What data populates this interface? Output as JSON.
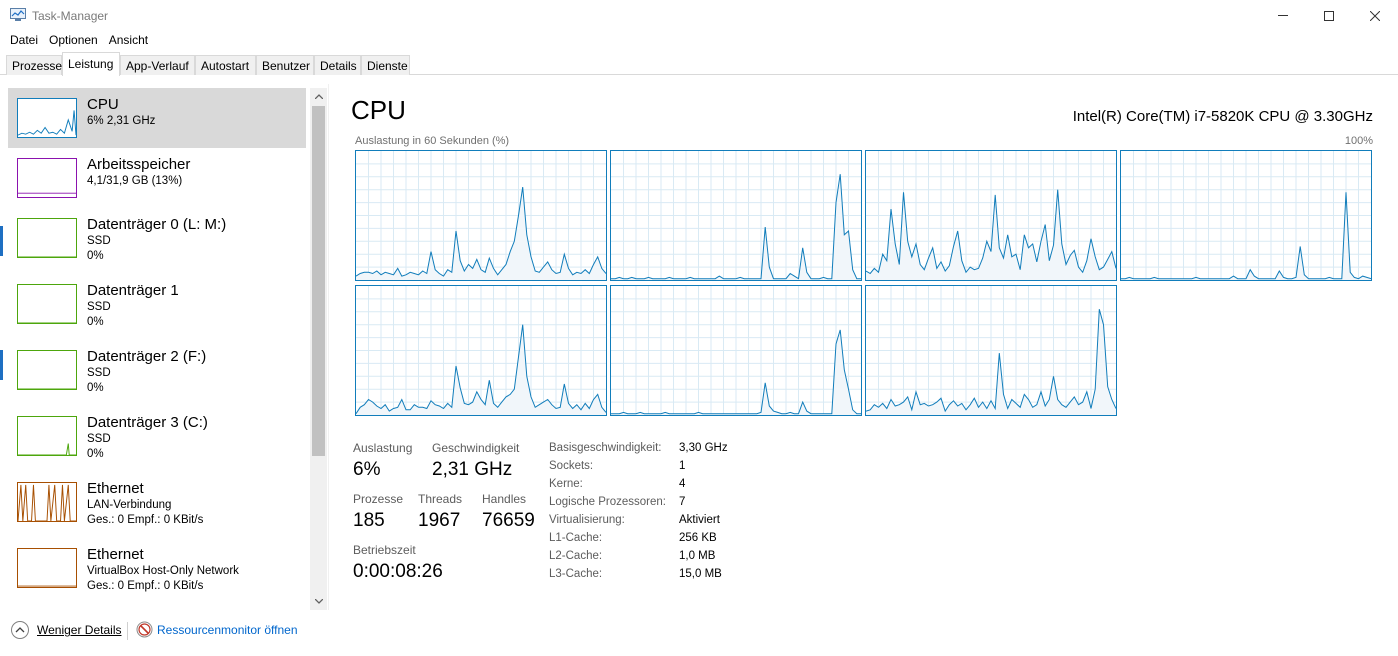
{
  "window": {
    "title": "Task-Manager"
  },
  "menu": [
    "Datei",
    "Optionen",
    "Ansicht"
  ],
  "tabs": [
    "Prozesse",
    "Leistung",
    "App-Verlauf",
    "Autostart",
    "Benutzer",
    "Details",
    "Dienste"
  ],
  "active_tab": "Leistung",
  "sidebar": {
    "items": [
      {
        "name": "CPU",
        "lines": [
          "6% 2,31 GHz"
        ],
        "color": "#117dbb",
        "selected": true
      },
      {
        "name": "Arbeitsspeicher",
        "lines": [
          "4,1/31,9 GB (13%)"
        ],
        "color": "#8b12ae"
      },
      {
        "name": "Datenträger 0 (L: M:)",
        "lines": [
          "SSD",
          "0%"
        ],
        "color": "#4da60c"
      },
      {
        "name": "Datenträger 1",
        "lines": [
          "SSD",
          "0%"
        ],
        "color": "#4da60c"
      },
      {
        "name": "Datenträger 2 (F:)",
        "lines": [
          "SSD",
          "0%"
        ],
        "color": "#4da60c"
      },
      {
        "name": "Datenträger 3 (C:)",
        "lines": [
          "SSD",
          "0%"
        ],
        "color": "#4da60c"
      },
      {
        "name": "Ethernet",
        "lines": [
          "LAN-Verbindung",
          "Ges.: 0 Empf.: 0 KBit/s"
        ],
        "color": "#a74f01"
      },
      {
        "name": "Ethernet",
        "lines": [
          "VirtualBox Host-Only Network",
          "Ges.: 0 Empf.: 0 KBit/s"
        ],
        "color": "#a74f01"
      }
    ]
  },
  "main": {
    "title": "CPU",
    "model": "Intel(R) Core(TM) i7-5820K CPU @ 3.30GHz",
    "graph_label": "Auslastung in 60 Sekunden (%)",
    "graph_max": "100%",
    "graph_color": "#117dbb",
    "stats": {
      "auslastung_label": "Auslastung",
      "auslastung": "6%",
      "geschw_label": "Geschwindigkeit",
      "geschw": "2,31 GHz",
      "prozesse_label": "Prozesse",
      "prozesse": "185",
      "threads_label": "Threads",
      "threads": "1967",
      "handles_label": "Handles",
      "handles": "76659",
      "betrieb_label": "Betriebszeit",
      "betrieb": "0:00:08:26"
    },
    "details": [
      {
        "label": "Basisgeschwindigkeit:",
        "value": "3,30 GHz"
      },
      {
        "label": "Sockets:",
        "value": "1"
      },
      {
        "label": "Kerne:",
        "value": "4"
      },
      {
        "label": "Logische Prozessoren:",
        "value": "7"
      },
      {
        "label": "Virtualisierung:",
        "value": "Aktiviert"
      },
      {
        "label": "L1-Cache:",
        "value": "256 KB"
      },
      {
        "label": "L2-Cache:",
        "value": "1,0 MB"
      },
      {
        "label": "L3-Cache:",
        "value": "15,0 MB"
      }
    ]
  },
  "bottom": {
    "less_details": "Weniger Details",
    "resource_monitor": "Ressourcenmonitor öffnen"
  }
}
